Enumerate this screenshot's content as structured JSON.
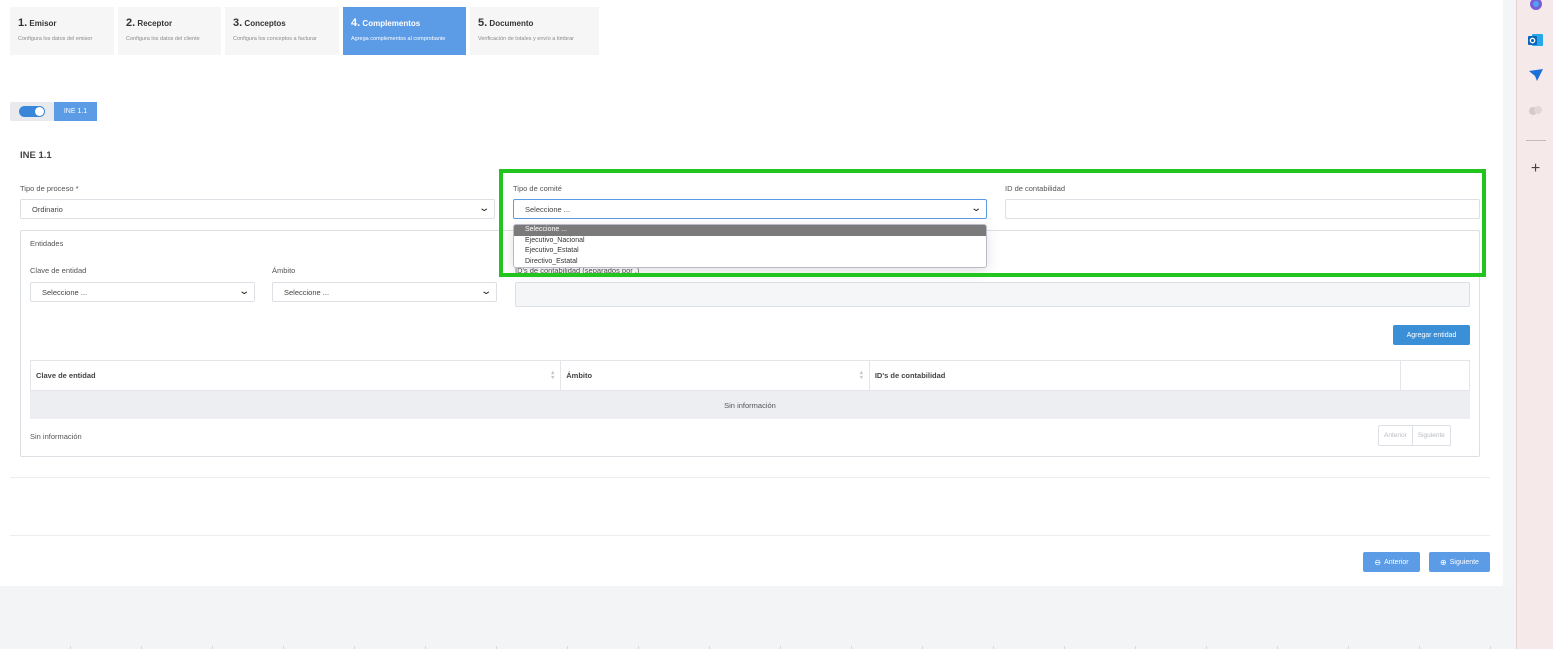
{
  "steps": [
    {
      "num": "1.",
      "title": "Emisor",
      "subtitle": "Configura los datos del emisor",
      "active": false
    },
    {
      "num": "2.",
      "title": "Receptor",
      "subtitle": "Configura los datos del cliente",
      "active": false
    },
    {
      "num": "3.",
      "title": "Conceptos",
      "subtitle": "Configura los conceptos a facturar",
      "active": false
    },
    {
      "num": "4.",
      "title": "Complementos",
      "subtitle": "Agrega complementos al comprobante",
      "active": true
    },
    {
      "num": "5.",
      "title": "Documento",
      "subtitle": "Verificación de totales y envío a timbrar",
      "active": false
    }
  ],
  "toggle": {
    "on": true,
    "tag": "INE 1.1"
  },
  "section": {
    "title": "INE 1.1"
  },
  "form": {
    "tipo_proceso": {
      "label": "Tipo de proceso *",
      "value": "Ordinario"
    },
    "tipo_comite": {
      "label": "Tipo de comité",
      "value": "Seleccione ...",
      "options": [
        "Seleccione ...",
        "Ejecutivo_Nacional",
        "Ejecutivo_Estatal",
        "Directivo_Estatal"
      ]
    },
    "id_contabilidad": {
      "label": "ID de contabilidad",
      "value": ""
    }
  },
  "entidades": {
    "legend": "Entidades",
    "clave_label": "Clave de entidad",
    "clave_value": "Seleccione ...",
    "ambito_label": "Ámbito",
    "ambito_value": "Seleccione ...",
    "ids_label": "ID's de contabilidad (separados por ,)",
    "add_button": "Agregar entidad",
    "table": {
      "headers": [
        "Clave de entidad",
        "Ámbito",
        "ID's de contabilidad"
      ],
      "empty": "Sin información"
    },
    "footer_info": "Sin información",
    "pager": {
      "prev": "Anterior",
      "next": "Siguiente"
    }
  },
  "nav": {
    "prev": "Anterior",
    "next": "Siguiente"
  },
  "sidebar_icons": [
    "copilot-icon",
    "outlook-icon",
    "send-icon",
    "feedback-icon",
    "add-icon"
  ],
  "colors": {
    "primary": "#5c9be6",
    "button": "#3a8fd6",
    "highlight": "#22c41e"
  }
}
